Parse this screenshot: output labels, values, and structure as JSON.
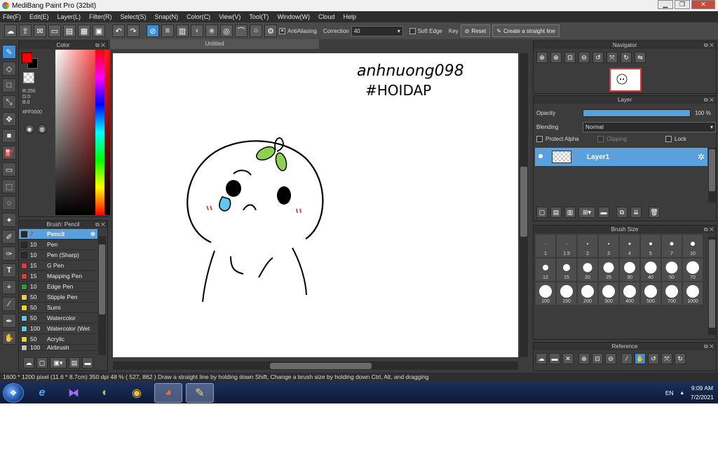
{
  "window": {
    "title": "MediBang Paint Pro (32bit)"
  },
  "menu": [
    "File(F)",
    "Edit(E)",
    "Layer(L)",
    "Filter(R)",
    "Select(S)",
    "Snap(N)",
    "Color(C)",
    "View(V)",
    "Tool(T)",
    "Window(W)",
    "Cloud",
    "Help"
  ],
  "toolbar": {
    "antialiasing_label": "AntiAliasing",
    "correction_label": "Correction",
    "correction_value": "40",
    "soft_edge_label": "Soft Edge",
    "key_label": "Key",
    "reset_label": "Reset",
    "straight_line_label": "Create a straight line"
  },
  "color_panel": {
    "title": "Color",
    "r": "R:255",
    "g": "G:0",
    "b": "B:0",
    "hex": "#FF0000",
    "foreground": "#ff0000",
    "background": "#000000"
  },
  "brush_panel": {
    "title": "Brush: Pencil",
    "items": [
      {
        "size": "7",
        "name": "Pencil",
        "color": "#2a2a2a",
        "selected": true
      },
      {
        "size": "10",
        "name": "Pen",
        "color": "#2a2a2a"
      },
      {
        "size": "10",
        "name": "Pen (Sharp)",
        "color": "#2a2a2a"
      },
      {
        "size": "15",
        "name": "G Pen",
        "color": "#e53935"
      },
      {
        "size": "15",
        "name": "Mapping Pen",
        "color": "#e53935"
      },
      {
        "size": "10",
        "name": "Edge Pen",
        "color": "#2ca02c"
      },
      {
        "size": "50",
        "name": "Stipple Pen",
        "color": "#f2d21b"
      },
      {
        "size": "50",
        "name": "Sumi",
        "color": "#f2d21b"
      },
      {
        "size": "50",
        "name": "Watercolor",
        "color": "#5ec8f0"
      },
      {
        "size": "100",
        "name": "Watercolor (Wet",
        "color": "#5ec8f0"
      },
      {
        "size": "50",
        "name": "Acrylic",
        "color": "#f2d21b"
      },
      {
        "size": "100",
        "name": "Airbrush",
        "color": "#bdbdbd"
      }
    ]
  },
  "canvas": {
    "tab": "Untitled",
    "handwritten_line1": "anhnuong098",
    "handwritten_line2": "#HOIDAP"
  },
  "navigator": {
    "title": "Navigator"
  },
  "layer_panel": {
    "title": "Layer",
    "opacity_label": "Opacity",
    "opacity_value": "100 %",
    "opacity_fraction": 1.0,
    "blending_label": "Blending",
    "blending_value": "Normal",
    "protect_alpha_label": "Protect Alpha",
    "clipping_label": "Clipping",
    "lock_label": "Lock",
    "layer_name": "Layer1"
  },
  "brush_size_panel": {
    "title": "Brush Size",
    "sizes": [
      "1",
      "1.5",
      "2",
      "3",
      "4",
      "5",
      "7",
      "10",
      "12",
      "15",
      "20",
      "25",
      "30",
      "40",
      "50",
      "70",
      "100",
      "150",
      "200",
      "300",
      "400",
      "500",
      "700",
      "1000"
    ]
  },
  "reference_panel": {
    "title": "Reference"
  },
  "status": {
    "text": "1600 * 1200 pixel  (11.6 * 8.7cm)  350 dpi  48 %  ( 527, 862 )  Draw a straight line by holding down Shift, Change a brush size by holding down Ctrl, Alt, and dragging"
  },
  "taskbar": {
    "language": "EN",
    "time": "9:09 AM",
    "date": "7/2/2021"
  }
}
